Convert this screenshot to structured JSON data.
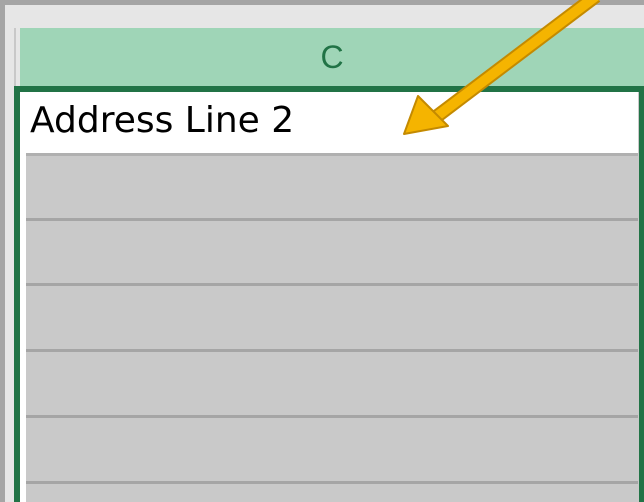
{
  "spreadsheet": {
    "column_header": {
      "label": "C"
    },
    "cells": [
      {
        "row": 1,
        "value": "Address Line 2",
        "selected": true
      },
      {
        "row": 2,
        "value": ""
      },
      {
        "row": 3,
        "value": ""
      },
      {
        "row": 4,
        "value": ""
      },
      {
        "row": 5,
        "value": ""
      },
      {
        "row": 6,
        "value": ""
      }
    ]
  },
  "annotation": {
    "icon": "pointer-arrow-icon",
    "color": "#f5b400"
  },
  "colors": {
    "header_bg": "#9fd5b7",
    "header_text": "#217346",
    "selection_border": "#217346",
    "range_fill": "#c9c9c9"
  }
}
